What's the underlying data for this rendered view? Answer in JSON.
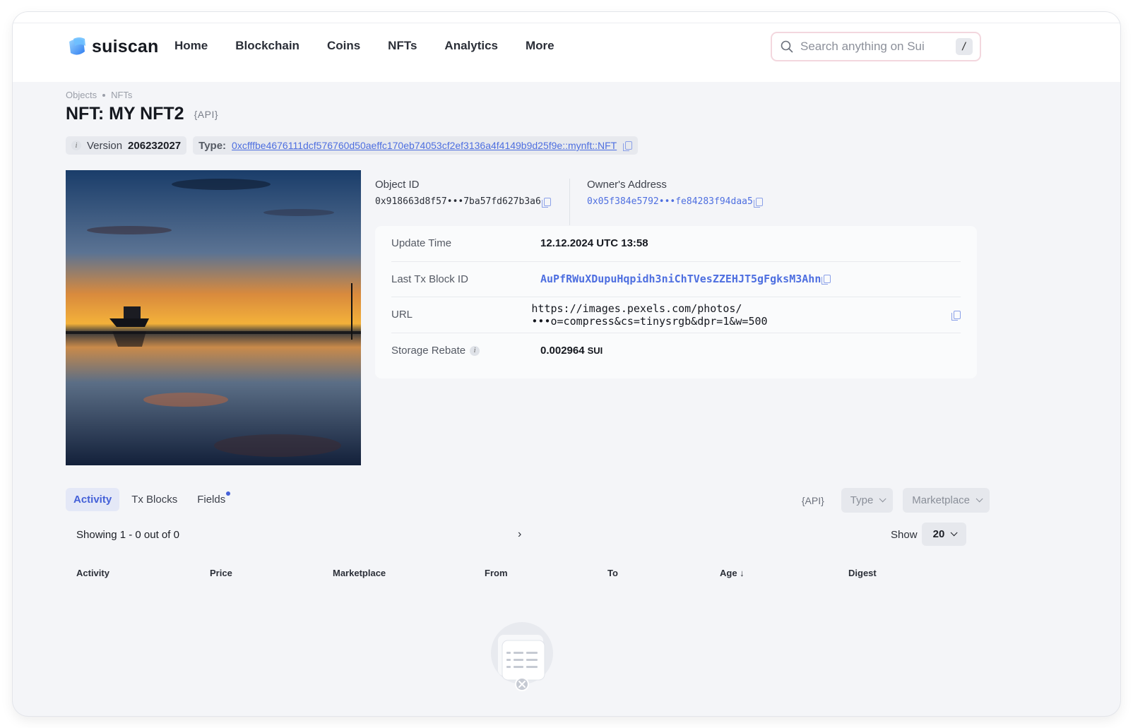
{
  "header": {
    "logo_text": "suiscan",
    "nav": [
      "Home",
      "Blockchain",
      "Coins",
      "NFTs",
      "Analytics",
      "More"
    ],
    "search_placeholder": "Search anything on Sui",
    "search_shortcut": "/"
  },
  "breadcrumb": [
    "Objects",
    "NFTs"
  ],
  "page": {
    "title": "NFT: MY NFT2",
    "api_tag": "{API}",
    "version_label": "Version",
    "version_value": "206232027",
    "type_label": "Type:",
    "type_value": "0xcfffbe4676111dcf576760d50aeffc170eb74053cf2ef3136a4f4149b9d25f9e::mynft::NFT"
  },
  "object": {
    "object_id_label": "Object ID",
    "object_id_value": "0x918663d8f57•••7ba57fd627b3a6",
    "owner_label": "Owner's Address",
    "owner_value": "0x05f384e5792•••fe84283f94daa5"
  },
  "details": [
    {
      "label": "Update Time",
      "value": "12.12.2024 UTC 13:58"
    },
    {
      "label": "Last Tx Block ID",
      "value": "AuPfRWuXDupuHqpidh3niChTVesZZEHJT5gFgksM3Ahn"
    },
    {
      "label": "URL",
      "value": "https://images.pexels.com/photos/•••o=compress&cs=tinysrgb&dpr=1&w=500"
    },
    {
      "label": "Storage Rebate",
      "value": "0.002964",
      "unit": "SUI"
    }
  ],
  "tabs": [
    "Activity",
    "Tx Blocks",
    "Fields"
  ],
  "filters": {
    "api": "{API}",
    "type": "Type",
    "marketplace": "Marketplace"
  },
  "pager": {
    "showing": "Showing 1 - 0 out of 0",
    "next": "›",
    "show_label": "Show",
    "page_size": "20"
  },
  "table": {
    "columns": [
      "Activity",
      "Price",
      "Marketplace",
      "From",
      "To",
      "Age ↓",
      "Digest"
    ]
  },
  "colors": {
    "accent": "#4561d8",
    "link": "#4e6fe0",
    "background": "#f4f5f8"
  }
}
